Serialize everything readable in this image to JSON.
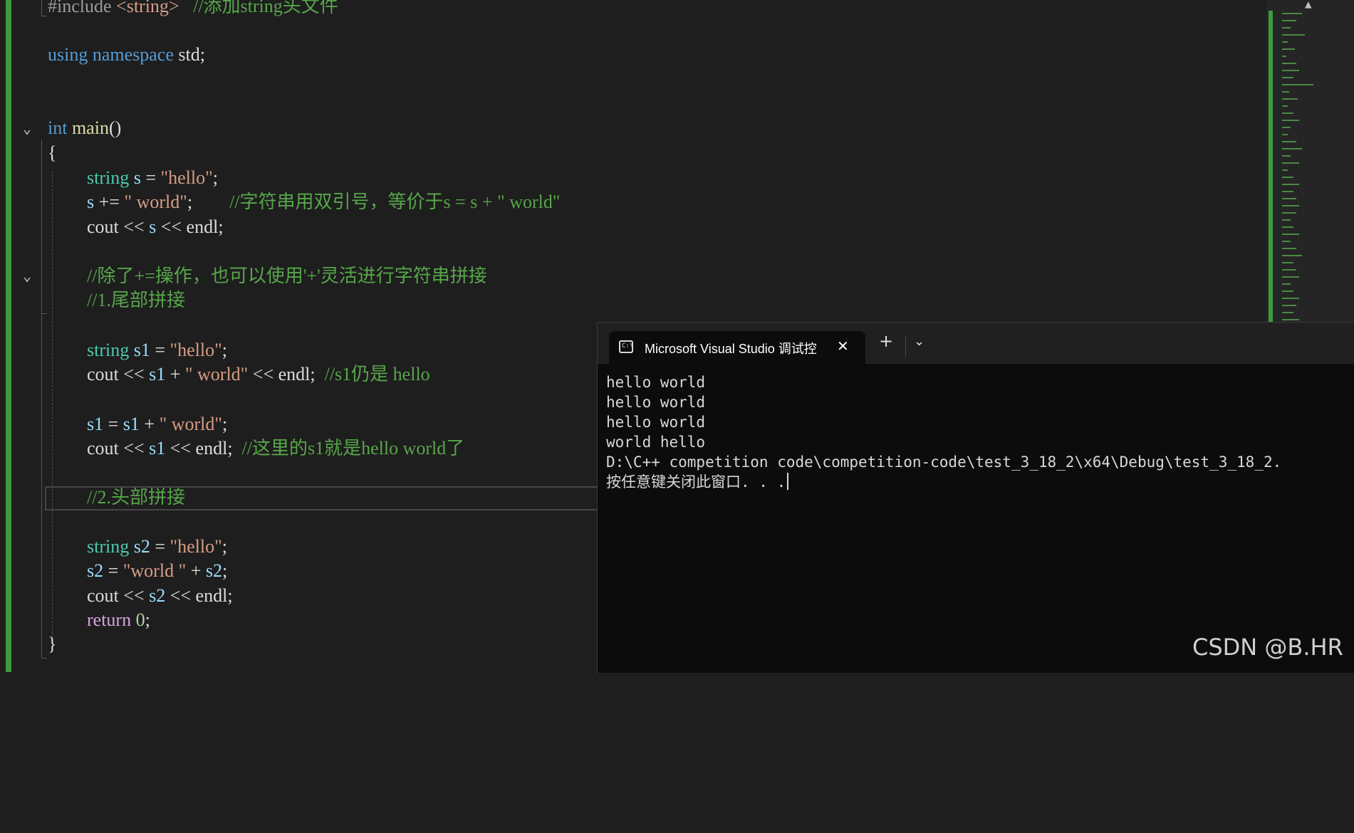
{
  "editor": {
    "lines": {
      "l1": {
        "pre": "#include",
        "inc": " <string>",
        "comment": "   //添加string头文件"
      },
      "l2": {
        "kw1": "using",
        "kw2": " namespace",
        "rest": " std;"
      },
      "l3": {
        "kw": "int",
        "fn": " main",
        "rest": "()"
      },
      "l4": {
        "text": "{"
      },
      "l5": {
        "ty": "string",
        "var": " s",
        "op": " = ",
        "str": "\"hello\"",
        "end": ";"
      },
      "l6": {
        "var": "s",
        "op": " += ",
        "str": "\" world\"",
        "end": ";",
        "comment": "        //字符串用双引号，等价于s = s + \" world\""
      },
      "l7": {
        "a": "cout",
        "b": " << ",
        "var": "s",
        "c": " << ",
        "d": "endl",
        "e": ";"
      },
      "l8": {
        "comment": "//除了+=操作，也可以使用'+'灵活进行字符串拼接"
      },
      "l9": {
        "comment": "//1.尾部拼接"
      },
      "l10": {
        "ty": "string",
        "var": " s1",
        "op": " = ",
        "str": "\"hello\"",
        "end": ";"
      },
      "l11": {
        "a": "cout",
        "b": " << ",
        "var": "s1",
        "c": " + ",
        "str": "\" world\"",
        "d": " << ",
        "e": "endl",
        "f": ";",
        "comment": "  //s1仍是 hello"
      },
      "l12": {
        "var1": "s1",
        "op": " = ",
        "var2": "s1",
        "op2": " + ",
        "str": "\" world\"",
        "end": ";"
      },
      "l13": {
        "a": "cout",
        "b": " << ",
        "var": "s1",
        "c": " << ",
        "d": "endl",
        "e": ";",
        "comment": "  //这里的s1就是hello world了"
      },
      "l14": {
        "comment": "//2.头部拼接"
      },
      "l15": {
        "ty": "string",
        "var": " s2",
        "op": " = ",
        "str": "\"hello\"",
        "end": ";"
      },
      "l16": {
        "var1": "s2",
        "op": " = ",
        "str": "\"world \"",
        "op2": " + ",
        "var2": "s2",
        "end": ";"
      },
      "l17": {
        "a": "cout",
        "b": " << ",
        "var": "s2",
        "c": " << ",
        "d": "endl",
        "e": ";"
      },
      "l18": {
        "kw": "return",
        "num": " 0",
        "end": ";"
      },
      "l19": {
        "text": "}"
      }
    }
  },
  "console": {
    "tab_title": "Microsoft Visual Studio 调试控",
    "tab_icon_text": "C:\\",
    "close_glyph": "✕",
    "new_tab_glyph": "+",
    "dropdown_glyph": "⌄",
    "output_lines": [
      "hello world",
      "hello world",
      "hello world",
      "world hello",
      "",
      "D:\\C++ competition code\\competition-code\\test_3_18_2\\x64\\Debug\\test_3_18_2.",
      "按任意键关闭此窗口. . ."
    ]
  },
  "watermark": "CSDN @B.HR",
  "colors": {
    "keyword": "#569cd6",
    "type": "#4ec9b0",
    "string": "#d69d85",
    "comment": "#57a64a",
    "change_bar": "#3d9a3d"
  }
}
